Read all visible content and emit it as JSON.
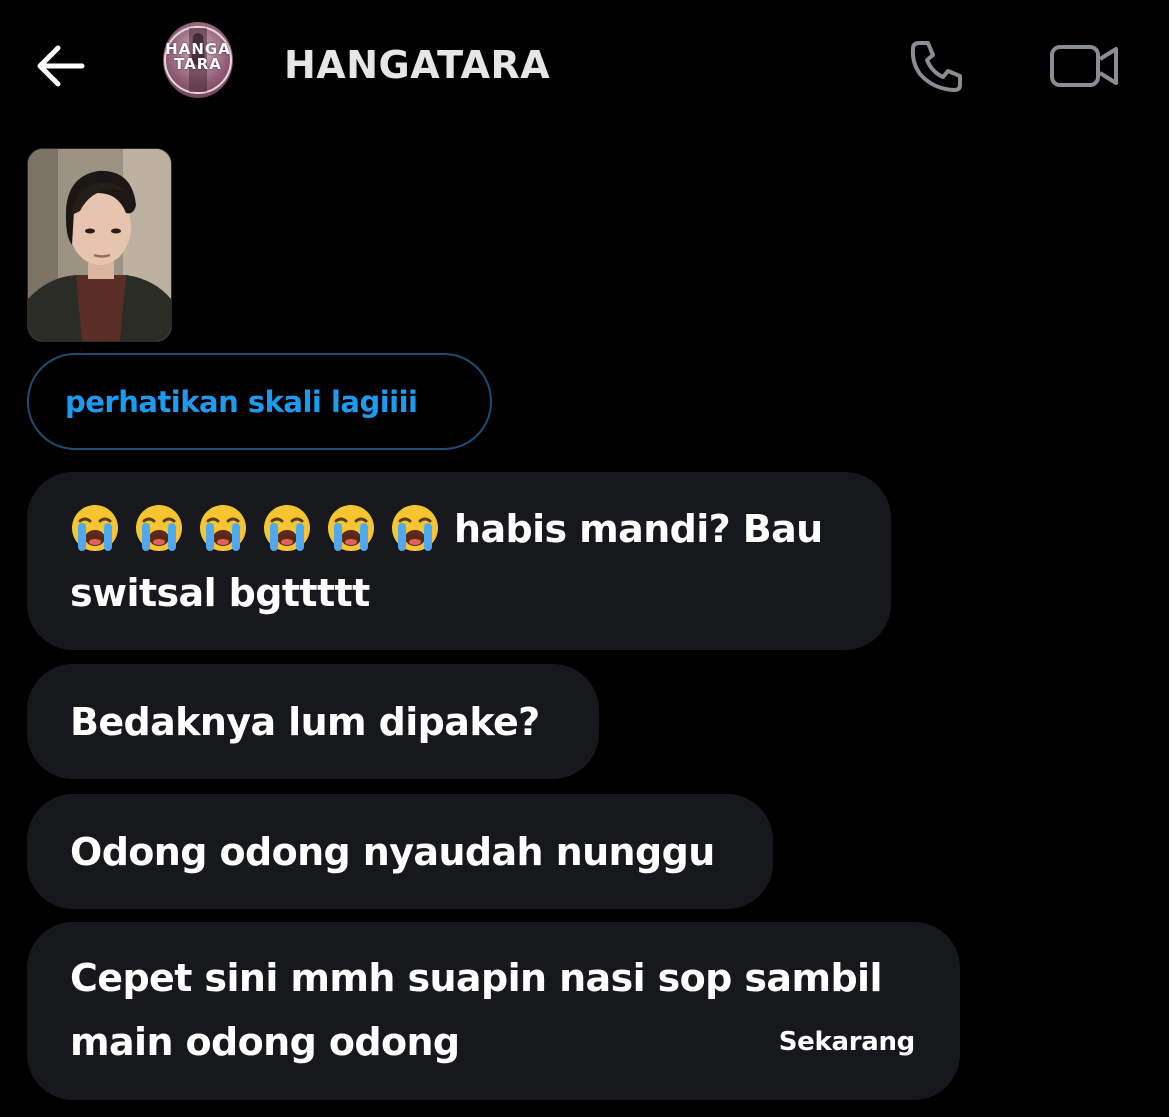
{
  "header": {
    "contact_name": "HANGATARA",
    "avatar_text": "HANGA\nTARA",
    "back_icon": "arrow-left-icon",
    "call_icon": "phone-icon",
    "video_icon": "video-camera-icon"
  },
  "reply": {
    "text": "perhatikan skali lagiiii"
  },
  "messages": [
    {
      "emoji_icon": "loudly-crying-face-icon",
      "emoji_count": 6,
      "text": "habis mandi? Bau switsal bgttttt"
    },
    {
      "text": "Bedaknya lum dipake?"
    },
    {
      "text": "Odong odong nyaudah nunggu"
    },
    {
      "text": "Cepet sini mmh suapin nasi sop sambil main odong odong",
      "timestamp": "Sekarang"
    }
  ],
  "colors": {
    "background": "#000000",
    "bubble": "#16181c",
    "accent": "#1d9bf0",
    "reply_border": "#1f4c73"
  }
}
